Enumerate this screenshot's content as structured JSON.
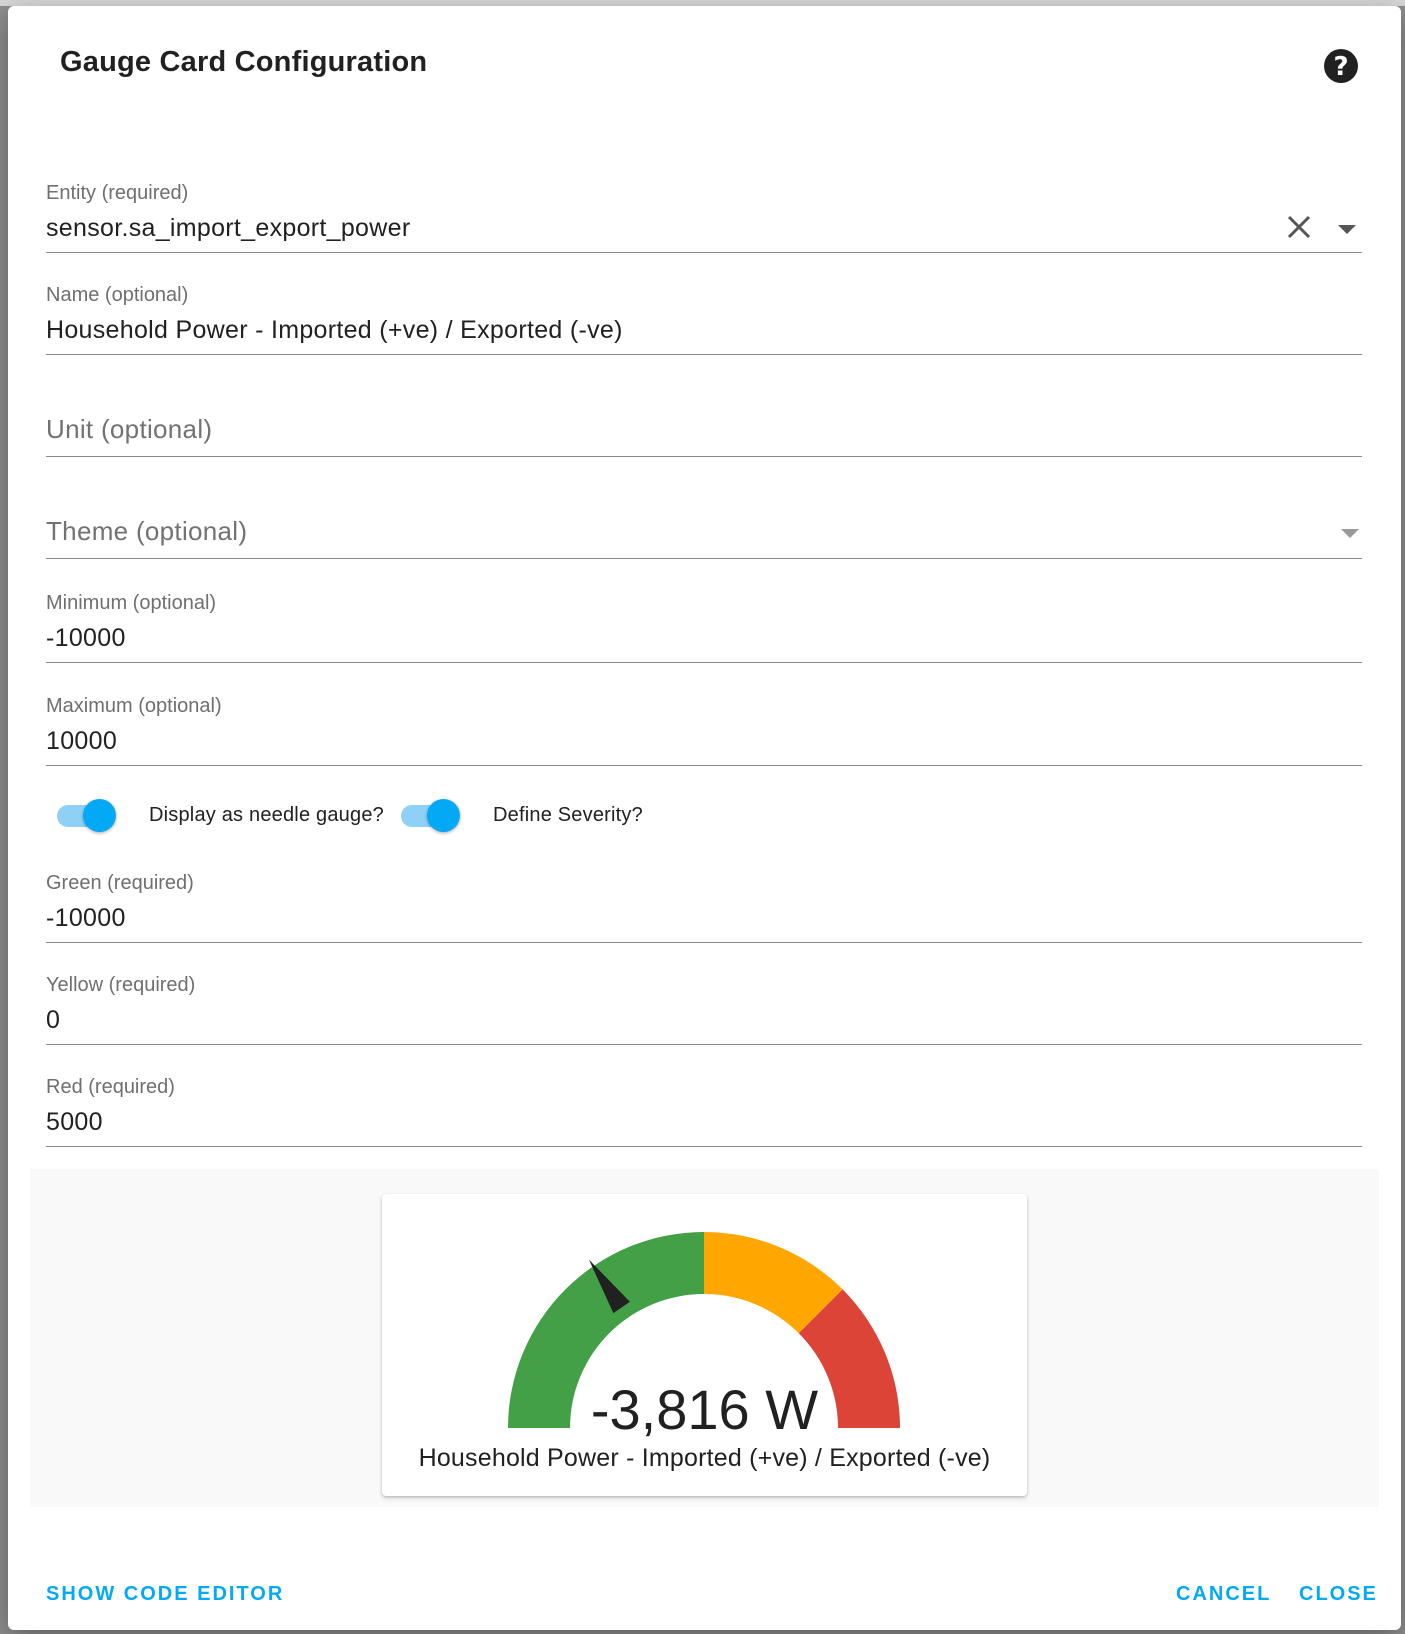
{
  "dialog": {
    "title": "Gauge Card Configuration",
    "help_icon": "help-circle-icon"
  },
  "fields": {
    "entity": {
      "label": "Entity (required)",
      "value": "sensor.sa_import_export_power"
    },
    "name": {
      "label": "Name (optional)",
      "value": "Household Power - Imported (+ve) / Exported (-ve)"
    },
    "unit": {
      "placeholder": "Unit (optional)",
      "value": ""
    },
    "theme": {
      "placeholder": "Theme (optional)",
      "value": ""
    },
    "minimum": {
      "label": "Minimum (optional)",
      "value": "-10000"
    },
    "maximum": {
      "label": "Maximum (optional)",
      "value": "10000"
    },
    "green": {
      "label": "Green (required)",
      "value": "-10000"
    },
    "yellow": {
      "label": "Yellow (required)",
      "value": "0"
    },
    "red": {
      "label": "Red (required)",
      "value": "5000"
    }
  },
  "toggles": {
    "needle": {
      "label": "Display as needle gauge?",
      "checked": true
    },
    "severity": {
      "label": "Define Severity?",
      "checked": true
    }
  },
  "preview": {
    "value_text": "-3,816 W",
    "name": "Household Power - Imported (+ve) / Exported (-ve)",
    "min": -10000,
    "max": 10000,
    "value": -3816,
    "segments": [
      {
        "from": -10000,
        "color": "#43a047"
      },
      {
        "from": 0,
        "color": "#ffa600"
      },
      {
        "from": 5000,
        "color": "#db4437"
      }
    ],
    "needle_color": "#212121"
  },
  "actions": {
    "show_code_editor": "SHOW CODE EDITOR",
    "cancel": "CANCEL",
    "close": "CLOSE"
  },
  "colors": {
    "accent": "#03a9f4",
    "switch_track": "#8fd0f6"
  }
}
